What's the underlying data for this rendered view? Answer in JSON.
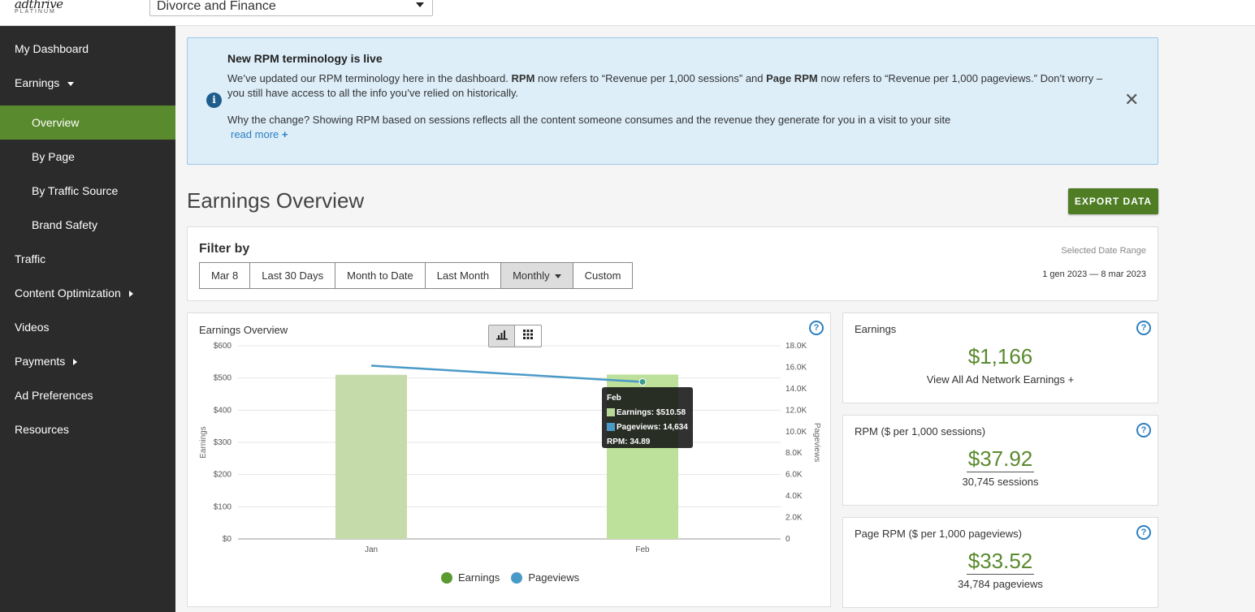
{
  "brand": {
    "name": "adthrive",
    "tier": "PLATINUM"
  },
  "site_select": {
    "value": "Divorce and Finance"
  },
  "sidebar": {
    "items": [
      {
        "label": "My Dashboard"
      },
      {
        "label": "Earnings"
      },
      {
        "label": "Overview"
      },
      {
        "label": "By Page"
      },
      {
        "label": "By Traffic Source"
      },
      {
        "label": "Brand Safety"
      },
      {
        "label": "Traffic"
      },
      {
        "label": "Content Optimization"
      },
      {
        "label": "Videos"
      },
      {
        "label": "Payments"
      },
      {
        "label": "Ad Preferences"
      },
      {
        "label": "Resources"
      }
    ]
  },
  "notice": {
    "title": "New RPM terminology is live",
    "body_1": "We’ve updated our RPM terminology here in the dashboard. ",
    "body_b1": "RPM",
    "body_2": " now refers to “Revenue per 1,000 sessions” and ",
    "body_b2": "Page RPM",
    "body_3": " now refers to “Revenue per 1,000 pageviews.” Don’t worry – you still have access to all the info you’ve relied on historically.",
    "body_why": "Why the change? Showing RPM based on sessions reflects all the content someone consumes and the revenue they generate for you in a visit to your site",
    "read_more": "read more",
    "read_more_plus": "+",
    "info_glyph": "i",
    "close_glyph": "✕"
  },
  "page": {
    "title": "Earnings Overview",
    "export_label": "EXPORT DATA"
  },
  "filter": {
    "label": "Filter by",
    "buttons": [
      "Mar 8",
      "Last 30 Days",
      "Month to Date",
      "Last Month",
      "Monthly",
      "Custom"
    ],
    "date_label": "Selected Date Range",
    "date_range": "1 gen 2023 — 8 mar 2023"
  },
  "chart_card": {
    "title": "Earnings Overview",
    "help": "?"
  },
  "chart_data": {
    "type": "bar",
    "categories": [
      "Jan",
      "Feb"
    ],
    "series": [
      {
        "name": "Earnings",
        "type": "bar",
        "axis": "left",
        "color": "#b8d89a",
        "values": [
          510,
          510.58
        ]
      },
      {
        "name": "Pageviews",
        "type": "line",
        "axis": "right",
        "color": "#4a9ac8",
        "values": [
          16150,
          14634
        ]
      }
    ],
    "ylabel": "Earnings",
    "y2label": "Pageviews",
    "ylim": [
      0,
      600
    ],
    "y2lim": [
      0,
      18000
    ],
    "y_ticks": [
      "$0",
      "$100",
      "$200",
      "$300",
      "$400",
      "$500",
      "$600"
    ],
    "y2_ticks": [
      "0",
      "2.0K",
      "4.0K",
      "6.0K",
      "8.0K",
      "10.0K",
      "12.0K",
      "14.0K",
      "16.0K",
      "18.0K"
    ],
    "grid": true,
    "legend": "bottom-center",
    "highlight": "Feb",
    "tooltip": {
      "title": "Feb",
      "lines": [
        "Earnings: $510.58",
        "Pageviews: 14,634",
        "RPM: 34.89"
      ]
    }
  },
  "legend": {
    "earnings": "Earnings",
    "pageviews": "Pageviews",
    "earnings_color": "#5a9a2e",
    "pageviews_color": "#4a9ac8"
  },
  "stats": {
    "earnings": {
      "label": "Earnings",
      "value": "$1,166",
      "sub": "View All Ad Network Earnings +"
    },
    "rpm": {
      "label": "RPM ($ per 1,000 sessions)",
      "value": "$37.92",
      "sub": "30,745 sessions"
    },
    "page_rpm": {
      "label": "Page RPM ($ per 1,000 pageviews)",
      "value": "$33.52",
      "sub": "34,784 pageviews"
    }
  }
}
